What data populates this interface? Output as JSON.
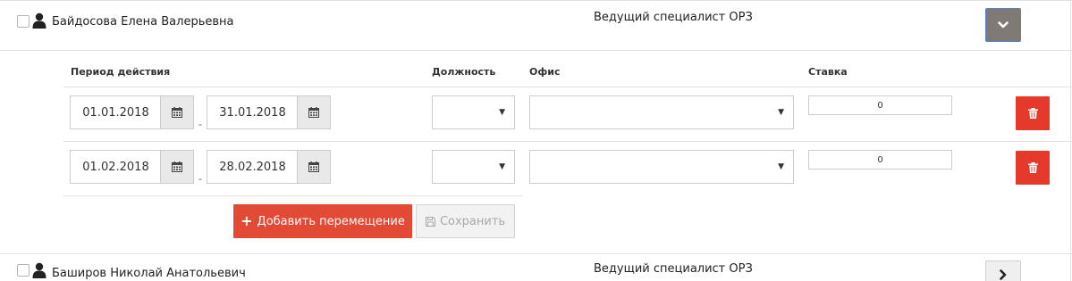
{
  "employees": [
    {
      "name": "Байдосова Елена Валерьевна",
      "position": "Ведущий специалист ОРЗ",
      "checked": false,
      "expanded": true
    },
    {
      "name": "Баширов Николай Анатольевич",
      "position": "Ведущий специалист ОРЗ",
      "checked": false,
      "expanded": false
    }
  ],
  "columns": {
    "period": "Период действия",
    "position": "Должность",
    "office": "Офис",
    "rate": "Ставка"
  },
  "assignments": [
    {
      "date_from": "01.01.2018",
      "date_to": "31.01.2018",
      "separator": "-",
      "position_value": "",
      "office_value": "",
      "rate": "0"
    },
    {
      "date_from": "01.02.2018",
      "date_to": "28.02.2018",
      "separator": "-",
      "position_value": "",
      "office_value": "",
      "rate": "0"
    }
  ],
  "actions": {
    "add_label": "Добавить перемещение",
    "save_label": "Сохранить"
  },
  "colors": {
    "accent_red": "#e4392b",
    "add_button": "#e24a36",
    "toggle_expanded": "#7f7b74"
  },
  "icons": {
    "person": "user-icon",
    "calendar": "calendar-icon",
    "delete": "trash-icon",
    "expand": "chevron-down-icon",
    "collapse": "chevron-right-icon",
    "add": "plus-icon",
    "save": "floppy-disk-icon"
  }
}
